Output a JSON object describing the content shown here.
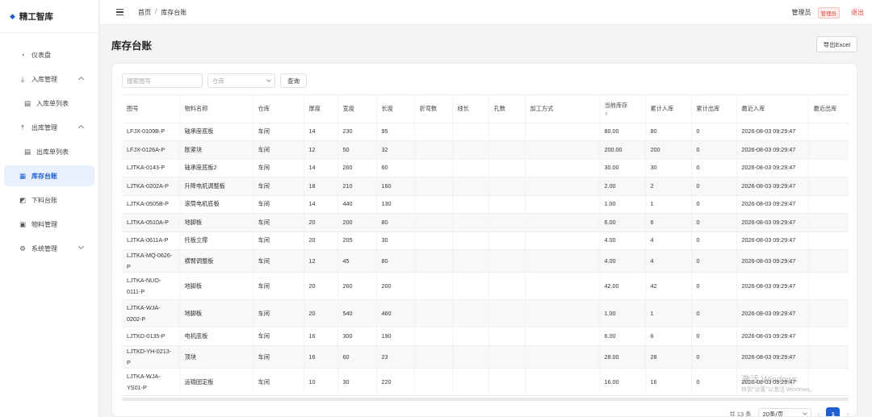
{
  "brand": {
    "title": "精工智库"
  },
  "sidebar": {
    "items": [
      {
        "label": "仪表盘",
        "icon": "gauge-icon"
      },
      {
        "label": "入库管理",
        "icon": "download-icon"
      },
      {
        "label": "入库单列表",
        "icon": "document-icon"
      },
      {
        "label": "出库管理",
        "icon": "upload-icon"
      },
      {
        "label": "出库单列表",
        "icon": "document-icon"
      },
      {
        "label": "库存台账",
        "icon": "ledger-icon"
      },
      {
        "label": "下料台账",
        "icon": "chart-icon"
      },
      {
        "label": "物料管理",
        "icon": "box-icon"
      },
      {
        "label": "系统管理",
        "icon": "gear-icon"
      }
    ]
  },
  "header": {
    "breadcrumb": [
      "首页",
      "/",
      "库存台账"
    ],
    "user": "管理员",
    "role": "管理员",
    "logout": "退出"
  },
  "main": {
    "title": "库存台账",
    "export_label": "导出Excel",
    "search_placeholder": "搜索图号",
    "warehouse_placeholder": "仓库",
    "query_label": "查询"
  },
  "table": {
    "columns": [
      "图号",
      "物料名称",
      "仓库",
      "厚度",
      "宽度",
      "长度",
      "折弯数",
      "线长",
      "孔数",
      "加工方式",
      "当前库存",
      "累计入库",
      "累计出库",
      "最近入库",
      "最近出库"
    ],
    "sort_icon": "⇕",
    "rows": [
      [
        "LFJX-0109B-P",
        "轴承座底板",
        "车间",
        "14",
        "230",
        "95",
        "",
        "",
        "",
        "",
        "80.00",
        "80",
        "0",
        "2026-08-03 09:29:47",
        ""
      ],
      [
        "LFJX-0126A-P",
        "胀紧块",
        "车间",
        "12",
        "50",
        "32",
        "",
        "",
        "",
        "",
        "200.00",
        "200",
        "0",
        "2026-08-03 09:29:47",
        ""
      ],
      [
        "LJTKA-0143-P",
        "轴承座底板2",
        "车间",
        "14",
        "260",
        "60",
        "",
        "",
        "",
        "",
        "30.00",
        "30",
        "0",
        "2026-08-03 09:29:47",
        ""
      ],
      [
        "LJTKA-0202A-P",
        "升降电机调整板",
        "车间",
        "18",
        "210",
        "160",
        "",
        "",
        "",
        "",
        "2.00",
        "2",
        "0",
        "2026-08-03 09:29:47",
        ""
      ],
      [
        "LJTKA-0505B-P",
        "滚筒电机底板",
        "车间",
        "14",
        "440",
        "130",
        "",
        "",
        "",
        "",
        "1.00",
        "1",
        "0",
        "2026-08-03 09:29:47",
        ""
      ],
      [
        "LJTKA-0510A-P",
        "地脚板",
        "车间",
        "20",
        "200",
        "80",
        "",
        "",
        "",
        "",
        "6.00",
        "6",
        "0",
        "2026-08-03 09:29:47",
        ""
      ],
      [
        "LJTKA-0611A-P",
        "托板立撑",
        "车间",
        "20",
        "205",
        "30",
        "",
        "",
        "",
        "",
        "4.00",
        "4",
        "0",
        "2026-08-03 09:29:47",
        ""
      ],
      [
        "LJTKA-MQ-0626-P",
        "横臂调整板",
        "车间",
        "12",
        "45",
        "80",
        "",
        "",
        "",
        "",
        "4.00",
        "4",
        "0",
        "2026-08-03 09:29:47",
        ""
      ],
      [
        "LJTKA-NUO-0111-P",
        "地脚板",
        "车间",
        "20",
        "260",
        "200",
        "",
        "",
        "",
        "",
        "42.00",
        "42",
        "0",
        "2026-08-03 09:29:47",
        ""
      ],
      [
        "LJTKA-WJA-0202-P",
        "地脚板",
        "车间",
        "20",
        "540",
        "460",
        "",
        "",
        "",
        "",
        "1.00",
        "1",
        "0",
        "2026-08-03 09:29:47",
        ""
      ],
      [
        "LJTKD-0135-P",
        "电机底板",
        "车间",
        "16",
        "300",
        "190",
        "",
        "",
        "",
        "",
        "6.00",
        "6",
        "0",
        "2026-08-03 09:29:47",
        ""
      ],
      [
        "LJTKD-YH-0213-P",
        "顶块",
        "车间",
        "16",
        "60",
        "23",
        "",
        "",
        "",
        "",
        "28.00",
        "28",
        "0",
        "2026-08-03 09:29:47",
        ""
      ],
      [
        "LJTKA-WJA-YS01-P",
        "运输固定板",
        "车间",
        "10",
        "30",
        "220",
        "",
        "",
        "",
        "",
        "16.00",
        "16",
        "0",
        "2026-08-03 09:29:47",
        ""
      ]
    ]
  },
  "pagination": {
    "total": "共 13 条",
    "page_size": "20条/页",
    "prev": "‹",
    "current": "1",
    "next": "›"
  },
  "watermark": {
    "line1": "激活 Windows",
    "line2": "转到\"设置\"以激活 Windows。"
  },
  "colors": {
    "accent": "#1f5fd1",
    "danger": "#e0463a",
    "active_bg": "#e8f0fd"
  }
}
